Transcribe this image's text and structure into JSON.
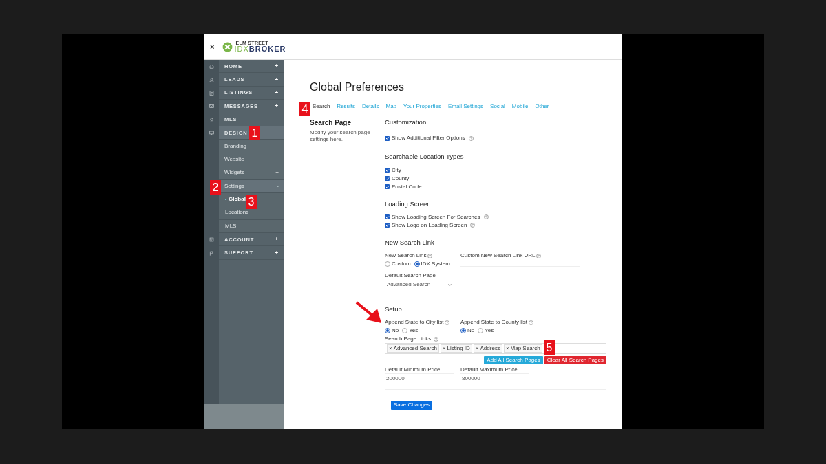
{
  "header": {
    "close": "×",
    "logo_small": "ELM STREET",
    "logo_idx": "IDX",
    "logo_broker": "BROKER"
  },
  "nav": [
    {
      "label": "HOME",
      "toggle": "+",
      "expanded": false
    },
    {
      "label": "LEADS",
      "toggle": "+",
      "expanded": false
    },
    {
      "label": "LISTINGS",
      "toggle": "+",
      "expanded": false
    },
    {
      "label": "MESSAGES",
      "toggle": "+",
      "expanded": false
    },
    {
      "label": "MLS",
      "expanded": false
    },
    {
      "label": "DESIGN",
      "toggle": "-",
      "expanded": true,
      "children": [
        {
          "label": "Branding",
          "toggle": "+",
          "expanded": false
        },
        {
          "label": "Website",
          "toggle": "+",
          "expanded": false
        },
        {
          "label": "Widgets",
          "toggle": "+",
          "expanded": false
        },
        {
          "label": "Settings",
          "toggle": "-",
          "expanded": true,
          "children": [
            {
              "label": "Global",
              "selected": true
            },
            {
              "label": "Locations",
              "selected": false
            },
            {
              "label": "MLS",
              "selected": false
            }
          ]
        }
      ]
    },
    {
      "label": "ACCOUNT",
      "toggle": "+",
      "expanded": false
    },
    {
      "label": "SUPPORT",
      "toggle": "+",
      "expanded": false
    }
  ],
  "page": {
    "title": "Global Preferences",
    "tabs": [
      {
        "label": "Search",
        "selected": true
      },
      {
        "label": "Results",
        "selected": false
      },
      {
        "label": "Details",
        "selected": false
      },
      {
        "label": "Map",
        "selected": false
      },
      {
        "label": "Your Properties",
        "selected": false
      },
      {
        "label": "Email Settings",
        "selected": false
      },
      {
        "label": "Social",
        "selected": false
      },
      {
        "label": "Mobile",
        "selected": false
      },
      {
        "label": "Other",
        "selected": false
      }
    ],
    "section_title": "Search Page",
    "section_description": "Modify your search page settings here.",
    "customization": {
      "title": "Customization",
      "items": [
        {
          "label": "Show Additional Filter Options",
          "checked": true,
          "help": true
        }
      ]
    },
    "location_types": {
      "title": "Searchable Location Types",
      "items": [
        {
          "label": "City",
          "checked": true,
          "help": false
        },
        {
          "label": "County",
          "checked": true,
          "help": false
        },
        {
          "label": "Postal Code",
          "checked": true,
          "help": false
        }
      ]
    },
    "loading_screen": {
      "title": "Loading Screen",
      "items": [
        {
          "label": "Show Loading Screen For Searches",
          "checked": true,
          "help": true
        },
        {
          "label": "Show Logo on Loading Screen",
          "checked": true,
          "help": true
        }
      ]
    },
    "new_search_link": {
      "title": "New Search Link",
      "radio": {
        "label": "New Search Link",
        "help": true,
        "options": [
          {
            "label": "Custom",
            "selected": false
          },
          {
            "label": "IDX System",
            "selected": true
          }
        ]
      },
      "url_label": "Custom New Search Link URL",
      "url_help": true,
      "default_page_label": "Default Search Page",
      "default_page_value": "Advanced Search"
    },
    "setup": {
      "title": "Setup",
      "radios": [
        {
          "label": "Append State to City list",
          "help": true,
          "options": [
            {
              "label": "No",
              "selected": true
            },
            {
              "label": "Yes",
              "selected": false
            }
          ]
        },
        {
          "label": "Append State to County list",
          "help": true,
          "options": [
            {
              "label": "No",
              "selected": true
            },
            {
              "label": "Yes",
              "selected": false
            }
          ]
        }
      ],
      "links_label": "Search Page Links",
      "links_help": true,
      "links": [
        {
          "remove": "×",
          "label": "Advanced Search"
        },
        {
          "remove": "×",
          "label": "Listing ID"
        },
        {
          "remove": "×",
          "label": "Address"
        },
        {
          "remove": "×",
          "label": "Map Search"
        }
      ],
      "add_button": "Add All Search Pages",
      "clear_button": "Clear All Search Pages",
      "min_label": "Default Minimum Price",
      "min_value": "200000",
      "max_label": "Default Maximum Price",
      "max_value": "800000"
    },
    "save_button": "Save Changes"
  },
  "annotations": [
    {
      "label": "1"
    },
    {
      "label": "2"
    },
    {
      "label": "3"
    },
    {
      "label": "4"
    },
    {
      "label": "5"
    }
  ]
}
